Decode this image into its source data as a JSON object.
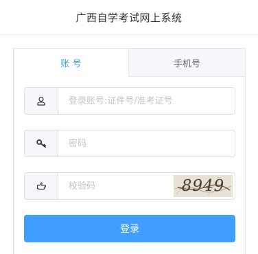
{
  "header": {
    "title": "广西自学考试网上系统"
  },
  "tabs": [
    {
      "label": "账 号",
      "active": true
    },
    {
      "label": "手机号",
      "active": false
    }
  ],
  "form": {
    "account": {
      "placeholder": "登录账号:证件号/准考证号",
      "value": "",
      "icon": "user-icon"
    },
    "password": {
      "placeholder": "密码",
      "value": "",
      "icon": "key-icon"
    },
    "captcha": {
      "placeholder": "校验码",
      "value": "",
      "icon": "hand-pointer-icon",
      "image_text": "8949"
    },
    "login_label": "登录"
  },
  "colors": {
    "accent": "#409eff",
    "border": "#dcdfe6",
    "addon_bg": "#f5f7fa"
  }
}
